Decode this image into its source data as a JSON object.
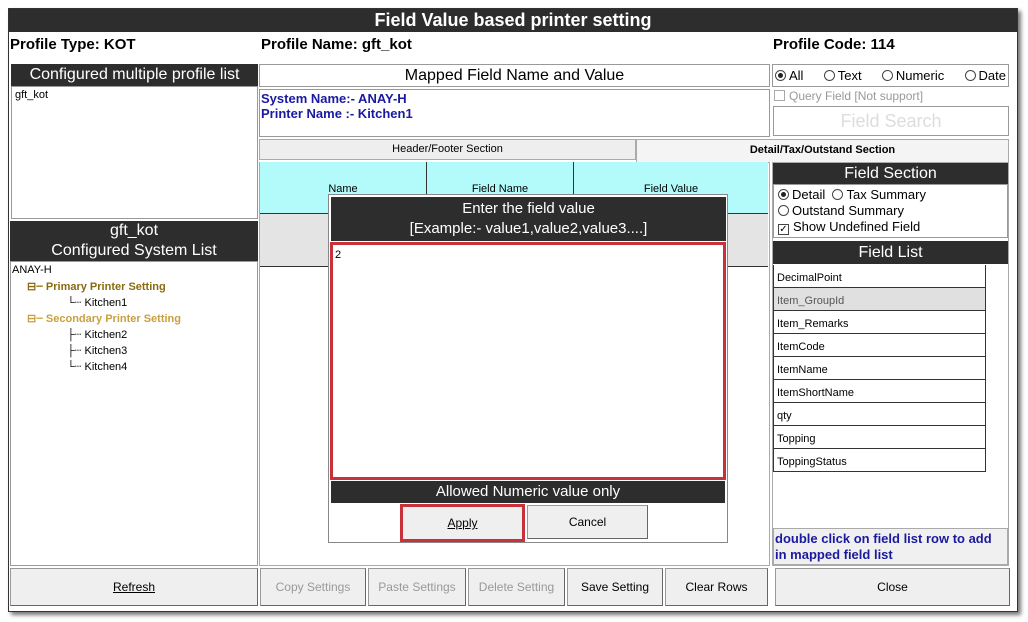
{
  "window": {
    "title": "Field Value based printer setting"
  },
  "profile": {
    "type": "Profile Type: KOT",
    "name": "Profile Name: gft_kot",
    "code": "Profile Code: 114"
  },
  "left": {
    "profile_list_title": "Configured multiple profile list",
    "profiles": [
      "gft_kot"
    ],
    "system_title_1": "gft_kot",
    "system_title_2": "Configured System List",
    "tree": {
      "root": "ANAY-H",
      "primary": "Primary Printer Setting",
      "primary_items": [
        "Kitchen1"
      ],
      "secondary": "Secondary Printer Setting",
      "secondary_items": [
        "Kitchen2",
        "Kitchen3",
        "Kitchen4"
      ]
    }
  },
  "middle": {
    "mapped_title": "Mapped Field Name and Value",
    "system_name": "System Name:- ANAY-H",
    "printer_name": "Printer Name :- Kitchen1",
    "tabs": [
      "Header/Footer Section",
      "Detail/Tax/Outstand Section"
    ],
    "columns": [
      "Name",
      "Field Name",
      "Field Value"
    ]
  },
  "dialog": {
    "title_1": "Enter the field value",
    "title_2": "[Example:- value1,value2,value3....]",
    "value": "2",
    "footer": "Allowed Numeric value only",
    "apply": "Apply",
    "cancel": "Cancel"
  },
  "right": {
    "filters": [
      "All",
      "Text",
      "Numeric",
      "Date"
    ],
    "selected_filter": "All",
    "query_field": "Query Field [Not support]",
    "field_search": "Field Search",
    "field_section_title": "Field Section",
    "sections": [
      "Detail",
      "Tax Summary",
      "Outstand Summary"
    ],
    "show_undefined": "Show Undefined Field",
    "field_list_title": "Field List",
    "fields": [
      "DecimalPoint",
      "Item_GroupId",
      "Item_Remarks",
      "ItemCode",
      "ItemName",
      "ItemShortName",
      "qty",
      "Topping",
      "ToppingStatus"
    ],
    "note": "double click on field list row to add in mapped field list"
  },
  "buttons": {
    "refresh": "Refresh",
    "copy": "Copy Settings",
    "paste": "Paste Settings",
    "delete": "Delete Setting",
    "save": "Save Setting",
    "clear": "Clear Rows",
    "close": "Close"
  }
}
